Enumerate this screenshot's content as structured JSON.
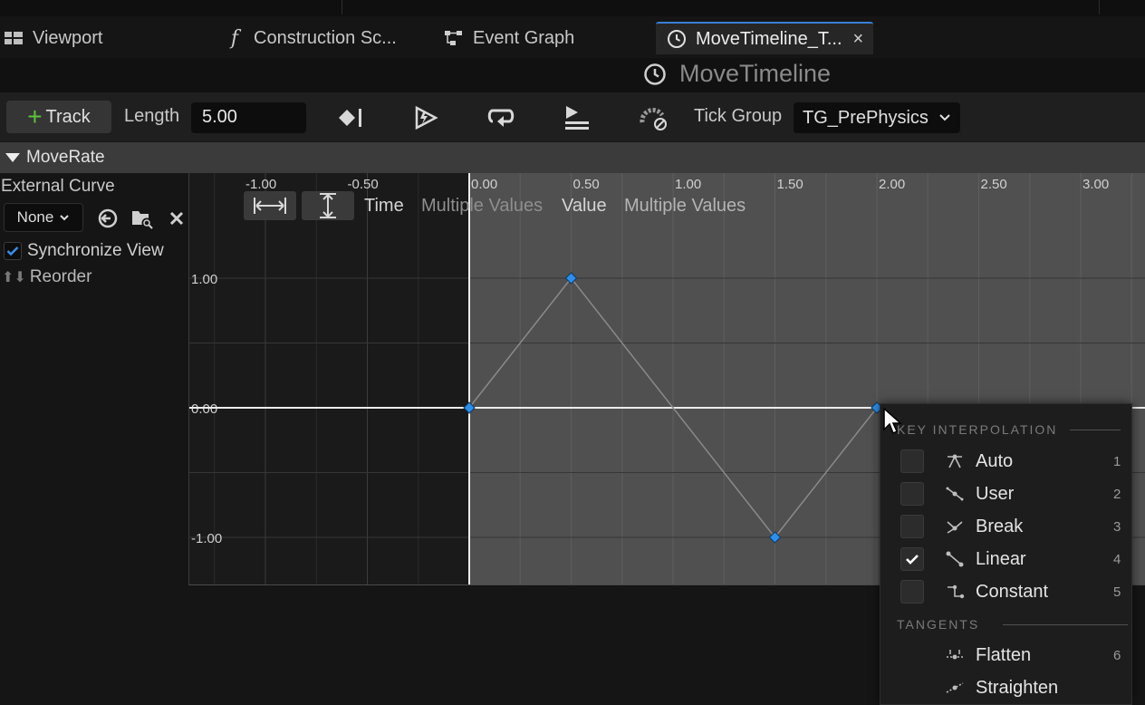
{
  "tabs": [
    {
      "label": "Viewport",
      "icon": "viewport-icon"
    },
    {
      "label": "Construction Sc...",
      "icon": "function-icon"
    },
    {
      "label": "Event Graph",
      "icon": "event-graph-icon"
    },
    {
      "label": "MoveTimeline_T...",
      "icon": "clock-icon",
      "active": true
    }
  ],
  "title": {
    "text": "MoveTimeline",
    "icon": "clock-icon"
  },
  "toolbar": {
    "track_label": "Track",
    "length_label": "Length",
    "length_value": "5.00",
    "tick_group_label": "Tick Group",
    "tick_group_value": "TG_PrePhysics"
  },
  "track": {
    "name": "MoveRate"
  },
  "left_panel": {
    "external_curve_label": "External Curve",
    "curve_select": "None",
    "synchronize_view_label": "Synchronize View",
    "synchronize_view_checked": true,
    "reorder_label": "Reorder"
  },
  "graph": {
    "time_label": "Time",
    "time_value": "Multiple Values",
    "value_label": "Value",
    "value_value": "Multiple Values",
    "x_ticks": [
      "-1.00",
      "-0.50",
      "0.00",
      "0.50",
      "1.00",
      "1.50",
      "2.00",
      "2.50",
      "3.00"
    ],
    "y_ticks": [
      "1.00",
      "0.00",
      "-1.00"
    ],
    "keys": [
      {
        "time": 0.0,
        "value": 0.0
      },
      {
        "time": 0.5,
        "value": 1.0
      },
      {
        "time": 1.5,
        "value": -1.0
      },
      {
        "time": 2.0,
        "value": 0.0
      }
    ],
    "key_color": "#2f8fe8"
  },
  "context_menu": {
    "interp_header": "KEY INTERPOLATION",
    "interp_items": [
      {
        "label": "Auto",
        "key": "1",
        "checked": false
      },
      {
        "label": "User",
        "key": "2",
        "checked": false
      },
      {
        "label": "Break",
        "key": "3",
        "checked": false
      },
      {
        "label": "Linear",
        "key": "4",
        "checked": true
      },
      {
        "label": "Constant",
        "key": "5",
        "checked": false
      }
    ],
    "tangents_header": "TANGENTS",
    "tangent_items": [
      {
        "label": "Flatten",
        "key": "6"
      },
      {
        "label": "Straighten",
        "key": ""
      }
    ]
  }
}
